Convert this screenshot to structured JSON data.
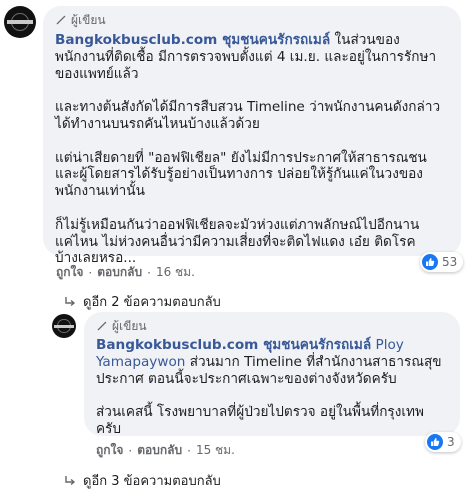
{
  "comments": [
    {
      "author_badge": "ผู้เขียน",
      "name": "Bangkokbusclub.com ชุมชนคนรักรถเมล์",
      "paragraphs": [
        [
          " ในส่วนของ",
          "พนักงานที่ติดเชื้อ มีการตรวจพบตั้งแต่ 4 เม.ย. และอยู่ในการรักษา",
          "ของแพทย์แล้ว"
        ],
        [
          "และทางต้นสังกัดได้มีการสืบสวน Timeline ว่าพนักงานคนดังกล่าว",
          "ได้ทำงานบนรถคันไหนบ้างแล้วด้วย"
        ],
        [
          "แต่น่าเสียดายที่ \"ออฟฟิเชียล\" ยังไม่มีการประกาศให้สาธารณชน",
          "และผู้โดยสารได้รับรู้อย่างเป็นทางการ ปล่อยให้รู้กันแค่ในวงของ",
          "พนักงานเท่านั้น"
        ],
        [
          "ก็ไม่รู้เหมือนกันว่าออฟฟิเชียลจะมัวห่วงแต่ภาพลักษณ์ไปอีกนาน",
          "แค่ไหน ไม่ห่วงคนอื่นว่ามีความเสี่ยงที่จะติดไฟแดง เอ๋ย ติดโรค",
          "บ้างเลยหรอ..."
        ]
      ],
      "actions": {
        "like": "ถูกใจ",
        "reply": "ตอบกลับ",
        "time": "16 ชม."
      },
      "reactions": "53",
      "more_replies": "ดูอีก 2 ข้อความตอบกลับ"
    },
    {
      "author_badge": "ผู้เขียน",
      "name": "Bangkokbusclub.com ชุมชนคนรักรถเมล์",
      "mention_line1": "Ploy",
      "mention_line2": "Yamapaywon",
      "paragraphs": [
        [
          " ส่วนมาก Timeline ที่สำนักงานสาธารณสุข",
          "ประกาศ ตอนนี้จะประกาศเฉพาะของต่างจังหวัดครับ"
        ],
        [
          "ส่วนเคสนี้ โรงพยาบาลที่ผู้ป่วยไปตรวจ อยู่ในพื้นที่กรุงเทพ",
          "ครับ"
        ]
      ],
      "actions": {
        "like": "ถูกใจ",
        "reply": "ตอบกลับ",
        "time": "15 ชม."
      },
      "reactions": "3",
      "more_replies": "ดูอีก 3 ข้อความตอบกลับ"
    }
  ],
  "colors": {
    "link_blue": "#385898",
    "bubble": "#f0f2f5",
    "like_blue": "#1877f2"
  },
  "icons": [
    "pen-icon",
    "like-icon",
    "reply-arrow-icon"
  ]
}
